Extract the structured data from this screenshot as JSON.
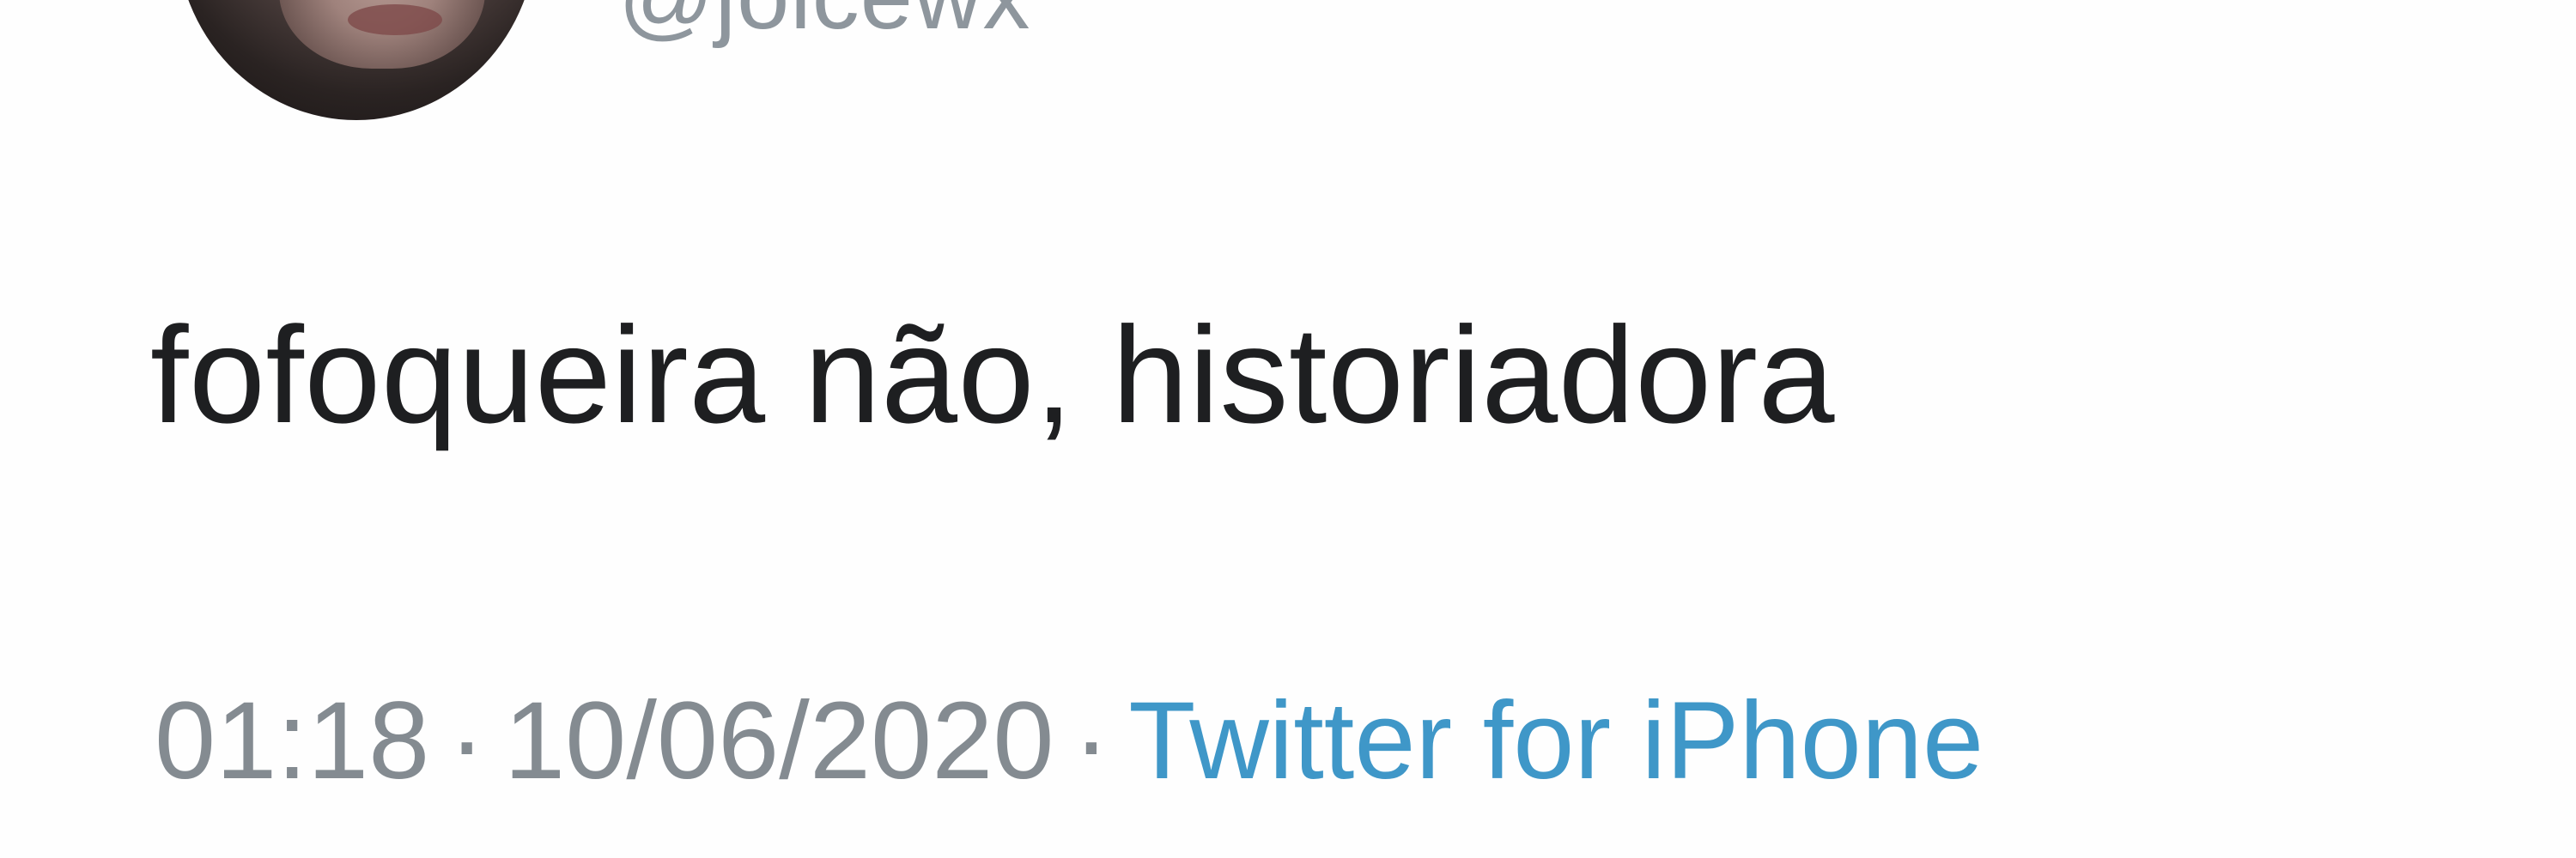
{
  "tweet": {
    "handle": "@joicewx",
    "text": "fofoqueira não, historiadora",
    "time": "01:18",
    "separator": "·",
    "date": "10/06/2020",
    "source": "Twitter for iPhone"
  },
  "colors": {
    "text": "#1e1f21",
    "meta": "#848b91",
    "link": "#3f97c8",
    "background": "#fefefe"
  }
}
